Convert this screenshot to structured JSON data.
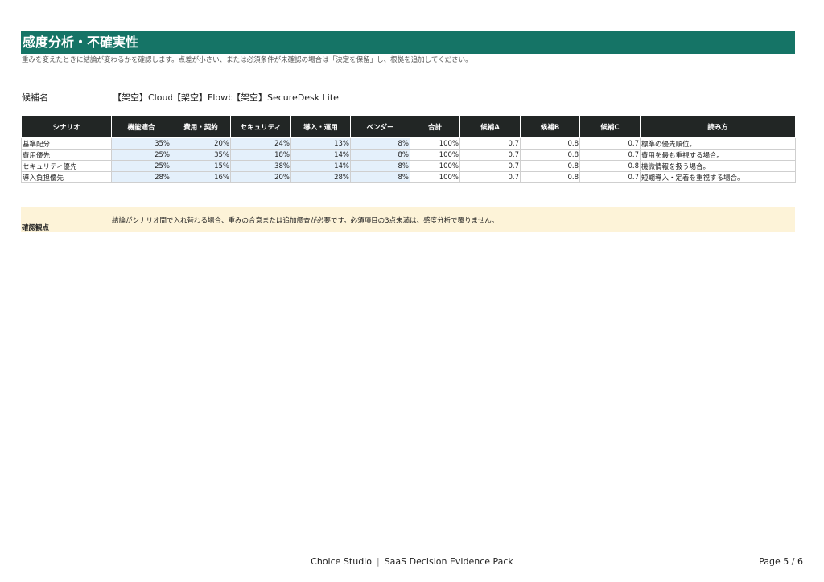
{
  "section": {
    "title": "感度分析・不確実性",
    "description": "重みを変えたときに結論が変わるかを確認します。点差が小さい、または必須条件が未確認の場合は「決定を保留」し、根拠を追加してください。"
  },
  "candidates": {
    "label": "候補名",
    "names": [
      "【架空】CloudDesk",
      "【架空】Flowboard",
      "【架空】SecureDesk Lite"
    ]
  },
  "table": {
    "headers": [
      "シナリオ",
      "機能適合",
      "費用・契約",
      "セキュリティ",
      "導入・運用",
      "ベンダー",
      "合計",
      "候補A",
      "候補B",
      "候補C",
      "読み方"
    ],
    "rows": [
      [
        "基準配分",
        "35%",
        "20%",
        "24%",
        "13%",
        "8%",
        "100%",
        "0.7",
        "0.8",
        "0.7",
        "標準の優先順位。"
      ],
      [
        "費用優先",
        "25%",
        "35%",
        "18%",
        "14%",
        "8%",
        "100%",
        "0.7",
        "0.8",
        "0.7",
        "費用を最も重視する場合。"
      ],
      [
        "セキュリティ優先",
        "25%",
        "15%",
        "38%",
        "14%",
        "8%",
        "100%",
        "0.7",
        "0.8",
        "0.8",
        "機微情報を扱う場合。"
      ],
      [
        "導入負担優先",
        "28%",
        "16%",
        "20%",
        "28%",
        "8%",
        "100%",
        "0.7",
        "0.8",
        "0.7",
        "短期導入・定着を重視する場合。"
      ]
    ]
  },
  "check": {
    "label": "確認観点",
    "text": "結論がシナリオ間で入れ替わる場合、重みの合意または追加調査が必要です。必須項目の3点未満は、感度分析で覆りません。"
  },
  "footer": {
    "brand": "Choice Studio",
    "separator": "|",
    "doc": "SaaS Decision Evidence Pack",
    "page": "Page 5 / 6"
  },
  "colors": {
    "title_bg": "#157466",
    "header_bg": "#222625",
    "weight_cell_bg": "#e4f0fb",
    "check_bg": "#fdf3d8"
  }
}
